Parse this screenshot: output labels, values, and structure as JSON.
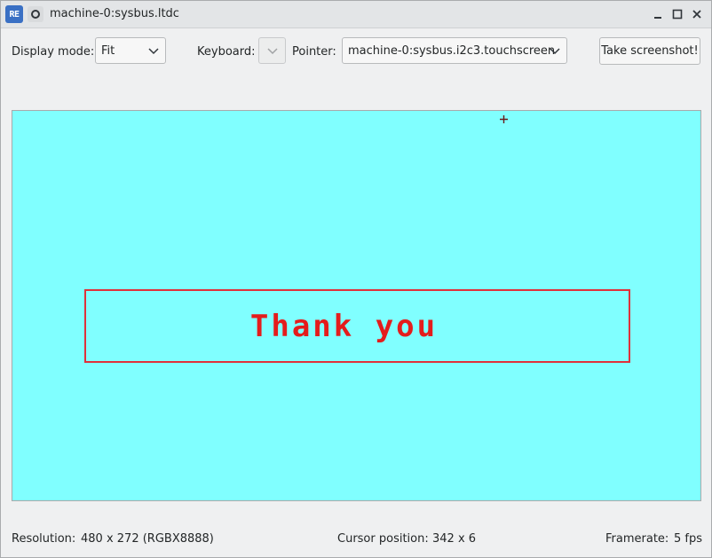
{
  "window": {
    "title": "machine-0:sysbus.ltdc",
    "app_icon_text": "RE",
    "icons": [
      "app-icon",
      "pin-icon",
      "minimize-icon",
      "maximize-icon",
      "close-icon"
    ]
  },
  "toolbar": {
    "display_mode_label": "Display mode:",
    "display_mode_value": "Fit",
    "keyboard_label": "Keyboard:",
    "keyboard_value": "",
    "pointer_label": "Pointer:",
    "pointer_value": "machine-0:sysbus.i2c3.touchscreen",
    "screenshot_button": "Take screenshot!"
  },
  "display": {
    "background_color": "#80ffff",
    "message": "Thank you",
    "message_color": "#e41c1c",
    "box_color": "#e0303a"
  },
  "status": {
    "resolution_label": "Resolution:",
    "resolution_value": "480 x 272 (RGBX8888)",
    "cursor_label": "Cursor position:",
    "cursor_value": "342 x 6",
    "framerate_label": "Framerate:",
    "framerate_value": "5 fps"
  }
}
